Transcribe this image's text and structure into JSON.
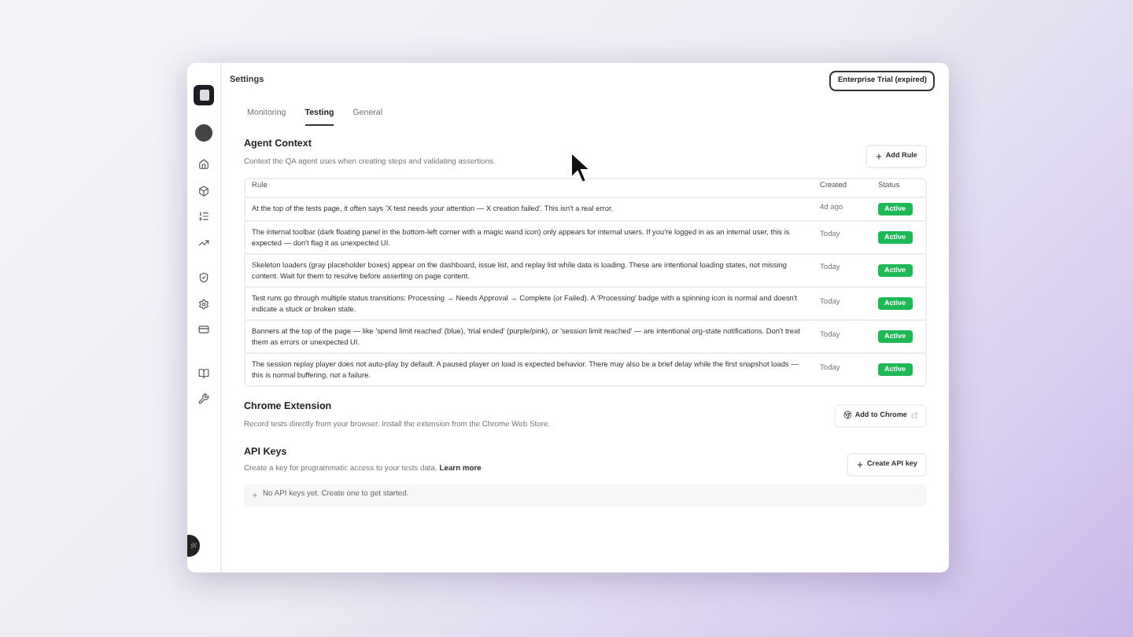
{
  "window": {
    "title": "Settings",
    "plan_badge": "Enterprise Trial (expired)"
  },
  "tabs": [
    {
      "label": "Monitoring",
      "selected": false
    },
    {
      "label": "Testing",
      "selected": true
    },
    {
      "label": "General",
      "selected": false
    }
  ],
  "agent_context": {
    "title": "Agent Context",
    "description": "Context the QA agent uses when creating steps and validating assertions.",
    "add_button": "Add Rule",
    "columns": [
      "Rule",
      "Created",
      "Status"
    ],
    "rows": [
      {
        "rule": "At the top of the tests page, it often says 'X test needs your attention — X creation failed'. This isn't a real error.",
        "created": "4d ago",
        "status": "Active"
      },
      {
        "rule": "The internal toolbar (dark floating panel in the bottom-left corner with a magic wand icon) only appears for internal users. If you're logged in as an internal user, this is expected — don't flag it as unexpected UI.",
        "created": "Today",
        "status": "Active"
      },
      {
        "rule": "Skeleton loaders (gray placeholder boxes) appear on the dashboard, issue list, and replay list while data is loading. These are intentional loading states, not missing content. Wait for them to resolve before asserting on page content.",
        "created": "Today",
        "status": "Active"
      },
      {
        "rule": "Test runs go through multiple status transitions: Processing → Needs Approval → Complete (or Failed). A 'Processing' badge with a spinning icon is normal and doesn't indicate a stuck or broken state.",
        "created": "Today",
        "status": "Active"
      },
      {
        "rule": "Banners at the top of the page — like 'spend limit reached' (blue), 'trial ended' (purple/pink), or 'session limit reached' — are intentional org-state notifications. Don't treat them as errors or unexpected UI.",
        "created": "Today",
        "status": "Active"
      },
      {
        "rule": "The session replay player does not auto-play by default. A paused player on load is expected behavior. There may also be a brief delay while the first snapshot loads — this is normal buffering, not a failure.",
        "created": "Today",
        "status": "Active"
      }
    ]
  },
  "chrome_extension": {
    "title": "Chrome Extension",
    "description": "Record tests directly from your browser. Install the extension from the Chrome Web Store.",
    "button": "Add to Chrome"
  },
  "api_keys": {
    "title": "API Keys",
    "description": "Create a key for programmatic access to your tests data.",
    "link": "Learn more",
    "button": "Create API key",
    "empty_text": "No API keys yet. Create one to get started."
  }
}
